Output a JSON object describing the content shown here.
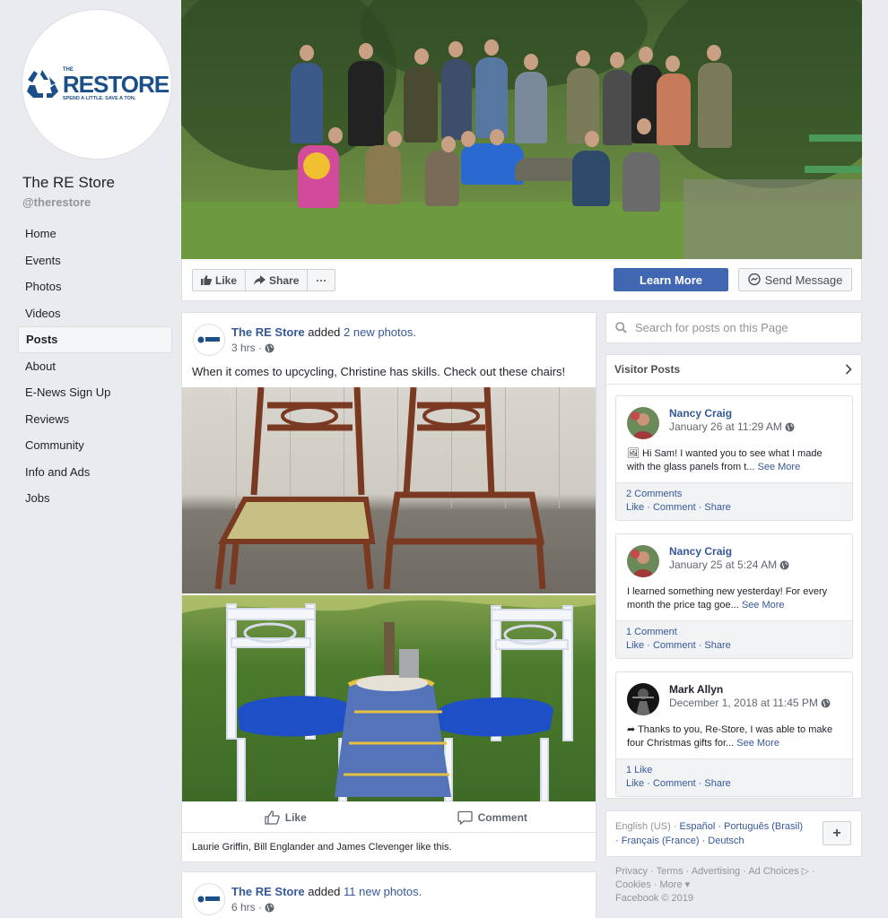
{
  "page": {
    "name": "The RE Store",
    "handle": "@therestore",
    "logo": {
      "the": "THE",
      "name": "RESTORE",
      "tagline": "SPEND A LITTLE. SAVE A TON."
    }
  },
  "nav": [
    "Home",
    "Events",
    "Photos",
    "Videos",
    "Posts",
    "About",
    "E-News Sign Up",
    "Reviews",
    "Community",
    "Info and Ads",
    "Jobs"
  ],
  "nav_active": "Posts",
  "actions": {
    "like": "Like",
    "share": "Share",
    "more": "···",
    "learn_more": "Learn More",
    "send_message": "Send Message"
  },
  "post": {
    "author": "The RE Store",
    "verb": "added",
    "object": "2 new photos.",
    "time": "3 hrs ·",
    "text": "When it comes to upcycling, Christine has skills. Check out these chairs!",
    "like": "Like",
    "comment": "Comment",
    "likers": "Laurie Griffin, Bill Englander and James Clevenger like this."
  },
  "post2": {
    "author": "The RE Store",
    "verb": "added",
    "object": "11 new photos.",
    "time": "6 hrs ·"
  },
  "search": {
    "placeholder": "Search for posts on this Page"
  },
  "visitor_posts": {
    "title": "Visitor Posts",
    "items": [
      {
        "name": "Nancy Craig",
        "time": "January 26 at 11:29 AM",
        "text": "🖼 Hi Sam! I wanted you to see what I made with the glass panels from t...",
        "see_more": "See More",
        "stat": "2 Comments",
        "actions": "Like · Comment · Share"
      },
      {
        "name": "Nancy Craig",
        "time": "January 25 at 5:24 AM",
        "text": "I learned something new yesterday! For every month the price tag goe...",
        "see_more": "See More",
        "stat": "1 Comment",
        "actions": "Like · Comment · Share"
      },
      {
        "name": "Mark Allyn",
        "time": "December 1, 2018 at 11:45 PM",
        "text": "➦ Thanks to you, Re-Store, I was able to make four Christmas gifts for...",
        "see_more": "See More",
        "stat": "1 Like",
        "actions": "Like · Comment · Share"
      }
    ]
  },
  "languages": {
    "current": "English (US) ·",
    "others_line1": "Español · Português (Brasil)",
    "others_line2": "· Français (France) · Deutsch",
    "plus": "+"
  },
  "footer": {
    "line1": "Privacy · Terms · Advertising · Ad Choices ▷ ·",
    "line2": "Cookies · More ▾",
    "line3": "Facebook © 2019"
  },
  "colors": {
    "brand": "#4267b2",
    "link": "#365899",
    "logo": "#1b4f8a",
    "background": "#e9ebee"
  }
}
